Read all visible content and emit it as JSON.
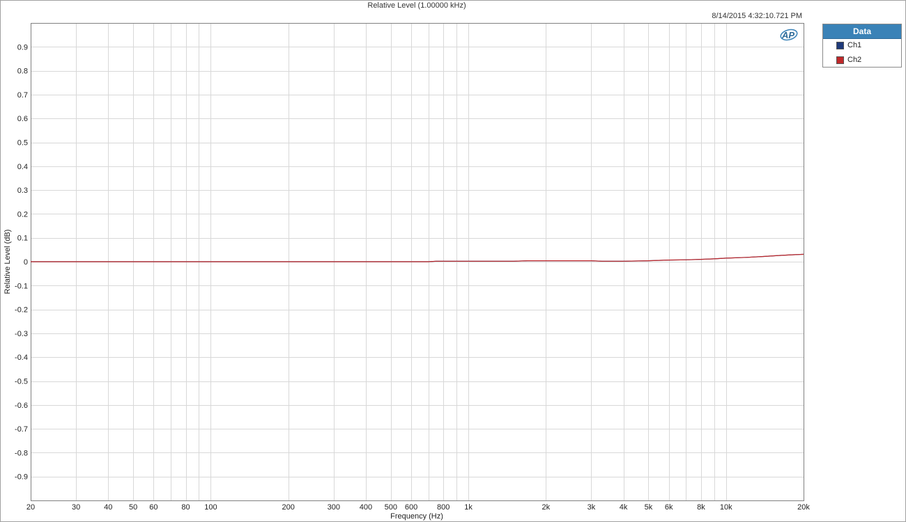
{
  "chart_data": {
    "type": "line",
    "title": "Relative Level (1.00000 kHz)",
    "timestamp": "8/14/2015 4:32:10.721 PM",
    "xlabel": "Frequency (Hz)",
    "ylabel": "Relative Level (dB)",
    "x_scale": "log",
    "xlim": [
      20,
      20000
    ],
    "ylim": [
      -1.0,
      1.0
    ],
    "grid": true,
    "legend_position": "top-right",
    "legend_title": "Data",
    "x_ticks": [
      {
        "value": 20,
        "label": "20"
      },
      {
        "value": 30,
        "label": "30"
      },
      {
        "value": 40,
        "label": "40"
      },
      {
        "value": 50,
        "label": "50"
      },
      {
        "value": 60,
        "label": "60"
      },
      {
        "value": 80,
        "label": "80"
      },
      {
        "value": 100,
        "label": "100"
      },
      {
        "value": 200,
        "label": "200"
      },
      {
        "value": 300,
        "label": "300"
      },
      {
        "value": 400,
        "label": "400"
      },
      {
        "value": 500,
        "label": "500"
      },
      {
        "value": 600,
        "label": "600"
      },
      {
        "value": 800,
        "label": "800"
      },
      {
        "value": 1000,
        "label": "1k"
      },
      {
        "value": 2000,
        "label": "2k"
      },
      {
        "value": 3000,
        "label": "3k"
      },
      {
        "value": 4000,
        "label": "4k"
      },
      {
        "value": 5000,
        "label": "5k"
      },
      {
        "value": 6000,
        "label": "6k"
      },
      {
        "value": 8000,
        "label": "8k"
      },
      {
        "value": 10000,
        "label": "10k"
      },
      {
        "value": 20000,
        "label": "20k"
      }
    ],
    "x_grid_minor": [
      70,
      90,
      700,
      900,
      7000,
      9000
    ],
    "y_ticks": [
      {
        "value": 0.9,
        "label": "0.9"
      },
      {
        "value": 0.8,
        "label": "0.8"
      },
      {
        "value": 0.7,
        "label": "0.7"
      },
      {
        "value": 0.6,
        "label": "0.6"
      },
      {
        "value": 0.5,
        "label": "0.5"
      },
      {
        "value": 0.4,
        "label": "0.4"
      },
      {
        "value": 0.3,
        "label": "0.3"
      },
      {
        "value": 0.2,
        "label": "0.2"
      },
      {
        "value": 0.1,
        "label": "0.1"
      },
      {
        "value": 0,
        "label": "0"
      },
      {
        "value": -0.1,
        "label": "-0.1"
      },
      {
        "value": -0.2,
        "label": "-0.2"
      },
      {
        "value": -0.3,
        "label": "-0.3"
      },
      {
        "value": -0.4,
        "label": "-0.4"
      },
      {
        "value": -0.5,
        "label": "-0.5"
      },
      {
        "value": -0.6,
        "label": "-0.6"
      },
      {
        "value": -0.7,
        "label": "-0.7"
      },
      {
        "value": -0.8,
        "label": "-0.8"
      },
      {
        "value": -0.9,
        "label": "-0.9"
      }
    ],
    "series": [
      {
        "name": "Ch1",
        "color": "#1f3a7a",
        "x": [
          20,
          50,
          100,
          200,
          500,
          700,
          750,
          800,
          1000,
          1500,
          1700,
          2000,
          3000,
          3300,
          4000,
          5000,
          6000,
          7000,
          8000,
          9000,
          10000,
          12000,
          14000,
          16000,
          18000,
          20000
        ],
        "y": [
          0,
          0,
          0,
          0,
          0,
          0,
          0.002,
          0.002,
          0.002,
          0.002,
          0.004,
          0.004,
          0.004,
          0.002,
          0.002,
          0.004,
          0.007,
          0.008,
          0.01,
          0.012,
          0.015,
          0.018,
          0.022,
          0.026,
          0.029,
          0.031
        ]
      },
      {
        "name": "Ch2",
        "color": "#c0282a",
        "x": [
          20,
          50,
          100,
          200,
          500,
          700,
          750,
          800,
          1000,
          1500,
          1700,
          2000,
          3000,
          3300,
          4000,
          5000,
          6000,
          7000,
          8000,
          9000,
          10000,
          12000,
          14000,
          16000,
          18000,
          20000
        ],
        "y": [
          0,
          0,
          0,
          0,
          0,
          0,
          0.002,
          0.002,
          0.002,
          0.002,
          0.004,
          0.004,
          0.004,
          0.002,
          0.002,
          0.004,
          0.007,
          0.008,
          0.01,
          0.012,
          0.015,
          0.018,
          0.022,
          0.026,
          0.029,
          0.031
        ]
      }
    ]
  },
  "logo": {
    "icon": "ap-logo-icon",
    "text": "AP"
  }
}
